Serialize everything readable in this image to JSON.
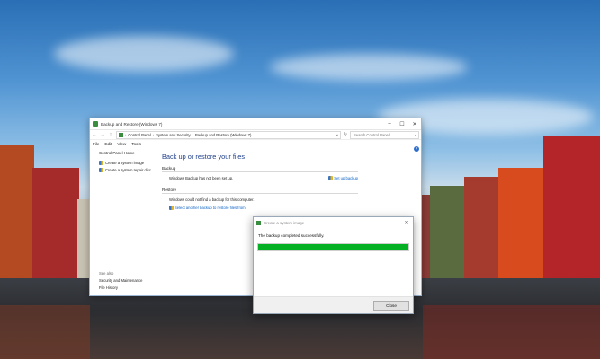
{
  "main_window": {
    "title": "Backup and Restore (Windows 7)",
    "caption": {
      "minimize": "–",
      "maximize": "☐",
      "close": "✕"
    },
    "nav": {
      "back": "←",
      "forward": "→",
      "up": "↑"
    },
    "address": [
      "Control Panel",
      "System and Security",
      "Backup and Restore (Windows 7)"
    ],
    "address_sep": "›",
    "search_placeholder": "Search Control Panel",
    "menu": [
      "File",
      "Edit",
      "View",
      "Tools"
    ],
    "left_pane": {
      "home": "Control Panel Home",
      "tasks": [
        "Create a system image",
        "Create a system repair disc"
      ],
      "see_also_header": "See also",
      "see_also": [
        "Security and Maintenance",
        "File History"
      ]
    },
    "content": {
      "heading": "Back up or restore your files",
      "backup_section": "Backup",
      "backup_status": "Windows Backup has not been set up.",
      "setup_link": "Set up backup",
      "restore_section": "Restore",
      "restore_status": "Windows could not find a backup for this computer.",
      "restore_link": "Select another backup to restore files from"
    }
  },
  "dialog": {
    "title": "Create a system image",
    "message": "The backup completed successfully.",
    "progress": 1.0,
    "close_label": "Close",
    "caption_close": "✕"
  },
  "colors": {
    "progress": "#06b025",
    "link": "#0b62c7",
    "heading": "#1e3f8a"
  }
}
